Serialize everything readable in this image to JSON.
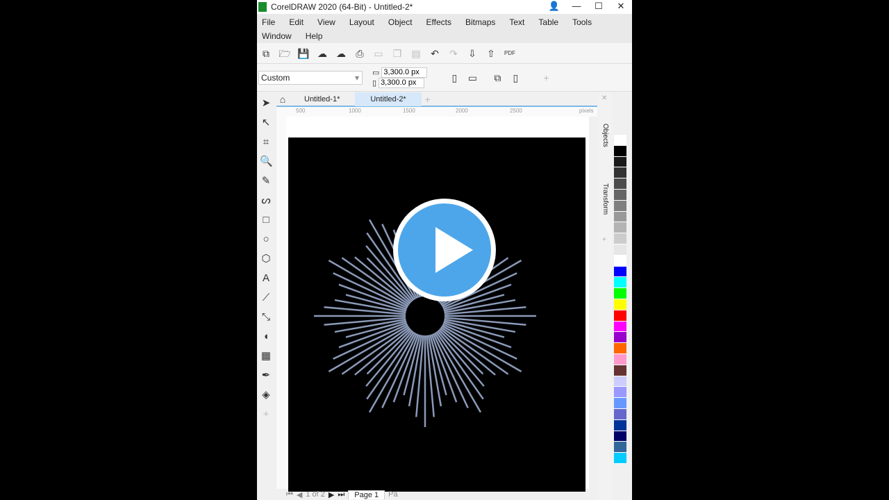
{
  "window": {
    "title": "CorelDRAW 2020 (64-Bit) - Untitled-2*"
  },
  "menu": [
    "File",
    "Edit",
    "View",
    "Layout",
    "Object",
    "Effects",
    "Bitmaps",
    "Text",
    "Table",
    "Tools",
    "Window",
    "Help"
  ],
  "property_bar": {
    "preset": "Custom",
    "width": "3,300.0 px",
    "height": "3,300.0 px"
  },
  "tabs": [
    {
      "label": "Untitled-1*"
    },
    {
      "label": "Untitled-2*",
      "active": true
    }
  ],
  "ruler": {
    "ticks": [
      "500",
      "1000",
      "1500",
      "2000",
      "2500"
    ],
    "unit": "pixels"
  },
  "dockers": [
    "Objects",
    "Transform"
  ],
  "status": {
    "page_tab": "Page 1",
    "page_tab2": "Pa",
    "page_info": "1 of 2"
  },
  "palette": [
    "#ffffff",
    "#000000",
    "#1a1a1a",
    "#333333",
    "#4d4d4d",
    "#666666",
    "#808080",
    "#999999",
    "#b3b3b3",
    "#cccccc",
    "#e6e6e6",
    "#ffffff",
    "#0000ff",
    "#00ffff",
    "#00ff00",
    "#ffff00",
    "#ff0000",
    "#ff00ff",
    "#9900cc",
    "#ff6600",
    "#ff99cc",
    "#663333",
    "#ccccff",
    "#9999ff",
    "#6699ff",
    "#6666cc",
    "#003399",
    "#000066",
    "#336699",
    "#00ccff"
  ],
  "accent": "#4ea6ea",
  "artwork": {
    "line_color": "#8b9ab8"
  }
}
